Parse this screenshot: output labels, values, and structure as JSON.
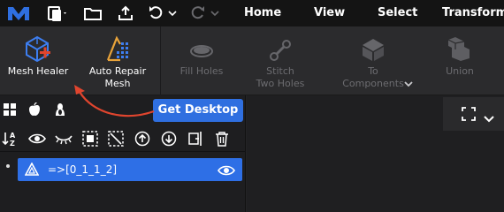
{
  "topbar": {
    "menus": [
      "Home",
      "View",
      "Select",
      "Transform"
    ],
    "icons": [
      "logo-icon",
      "new-file-icon",
      "folder-icon",
      "share-icon",
      "undo-icon",
      "redo-icon"
    ]
  },
  "ribbon": {
    "tools": [
      {
        "label": "Mesh Healer",
        "icon": "mesh-healer-icon",
        "enabled": true
      },
      {
        "label": "Auto Repair\nMesh",
        "icon": "auto-repair-icon",
        "enabled": true
      },
      {
        "label": "Fill Holes",
        "icon": "fill-holes-icon",
        "enabled": false
      },
      {
        "label": "Stitch\nTwo Holes",
        "icon": "stitch-icon",
        "enabled": false
      },
      {
        "label": "To\nComponents",
        "icon": "to-components-icon",
        "enabled": false
      },
      {
        "label": "Union",
        "icon": "union-icon",
        "enabled": false
      }
    ]
  },
  "panel": {
    "get_desktop": "Get Desktop",
    "object_name": "=>[0_1_1_2]"
  },
  "colors": {
    "accent": "#2f6fe0",
    "arrow": "#e0452e",
    "topbar_bg": "#141414"
  }
}
